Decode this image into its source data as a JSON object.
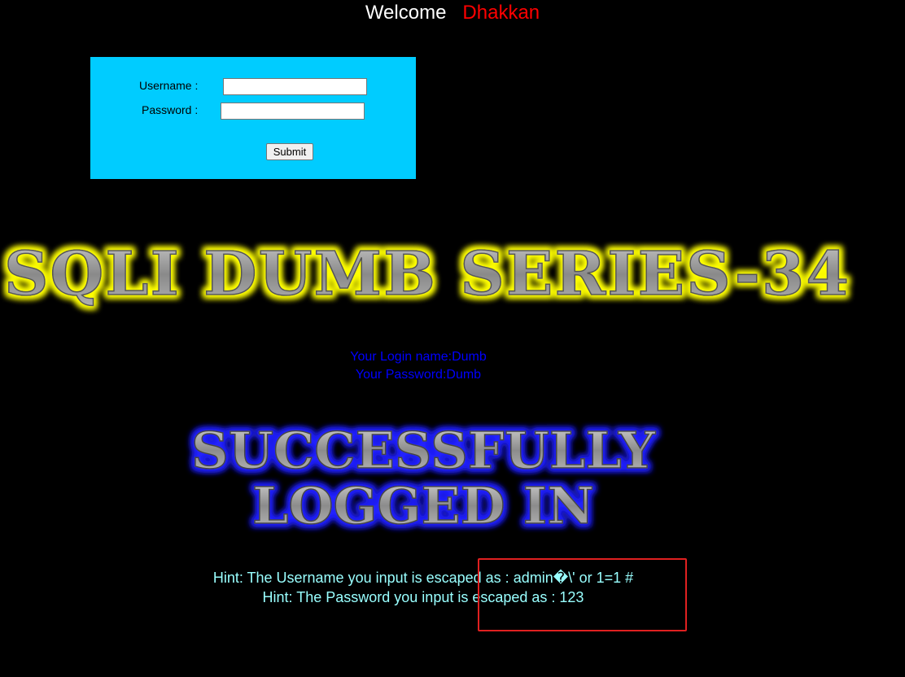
{
  "welcome": {
    "label": "Welcome",
    "name": "Dhakkan"
  },
  "form": {
    "username_label": "Username :",
    "password_label": "Password :",
    "username_value": "",
    "password_value": "",
    "submit_label": "Submit"
  },
  "banner": {
    "title": "SQLI DUMB SERIES-34"
  },
  "login_info": {
    "line1": "Your Login name:Dumb",
    "line2": "Your Password:Dumb"
  },
  "success": {
    "line1": "SUCCESSFULLY",
    "line2": "LOGGED IN"
  },
  "hints": {
    "line1": "Hint: The Username you input is escaped as : admin�\\' or 1=1 #",
    "line2": "Hint: The Password you input is escaped as : 123"
  },
  "colors": {
    "background": "#000000",
    "form_bg": "#00ccff",
    "welcome_name": "#ff0000",
    "login_info": "#0000ff",
    "hint": "#99ffff",
    "highlight": "#e02020",
    "banner_glow": "#ffff00",
    "success_glow": "#2222ff"
  }
}
